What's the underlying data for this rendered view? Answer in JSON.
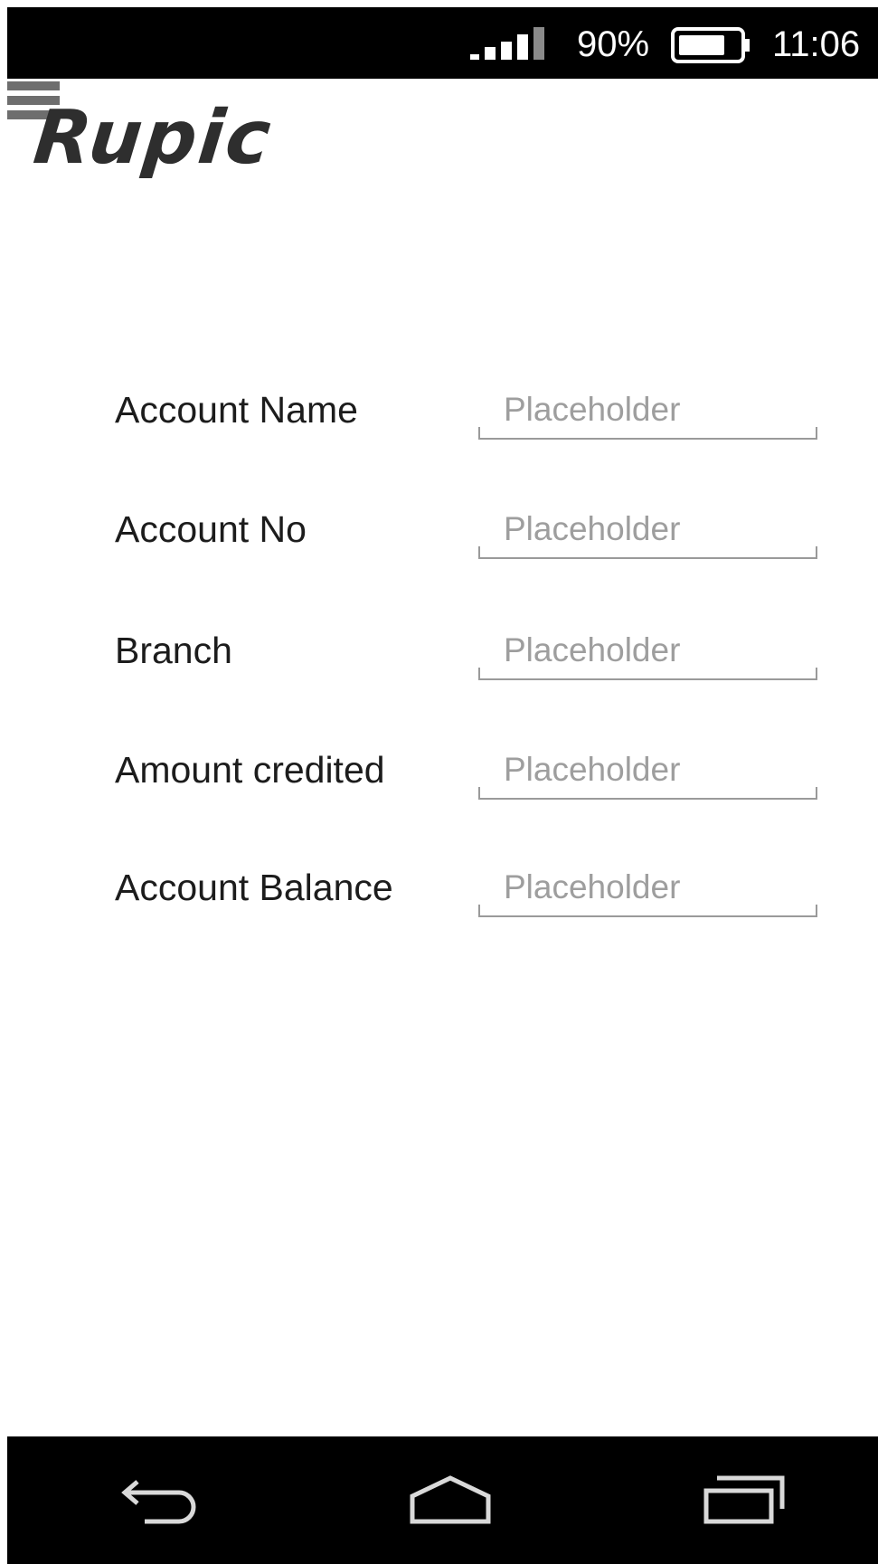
{
  "status_bar": {
    "battery_percent": "90%",
    "time": "11:06",
    "signal_icon": "signal-icon",
    "battery_icon": "battery-icon",
    "battery_level": 0.9
  },
  "logo": {
    "text": "Rupic"
  },
  "form": {
    "fields": [
      {
        "label": "Account Name",
        "placeholder": "Placeholder"
      },
      {
        "label": "Account No",
        "placeholder": "Placeholder"
      },
      {
        "label": "Branch",
        "placeholder": "Placeholder"
      },
      {
        "label": "Amount credited",
        "placeholder": "Placeholder"
      },
      {
        "label": "Account Balance",
        "placeholder": "Placeholder"
      }
    ]
  },
  "nav_bar": {
    "back_icon": "back-icon",
    "home_icon": "home-icon",
    "recents_icon": "recents-icon"
  }
}
